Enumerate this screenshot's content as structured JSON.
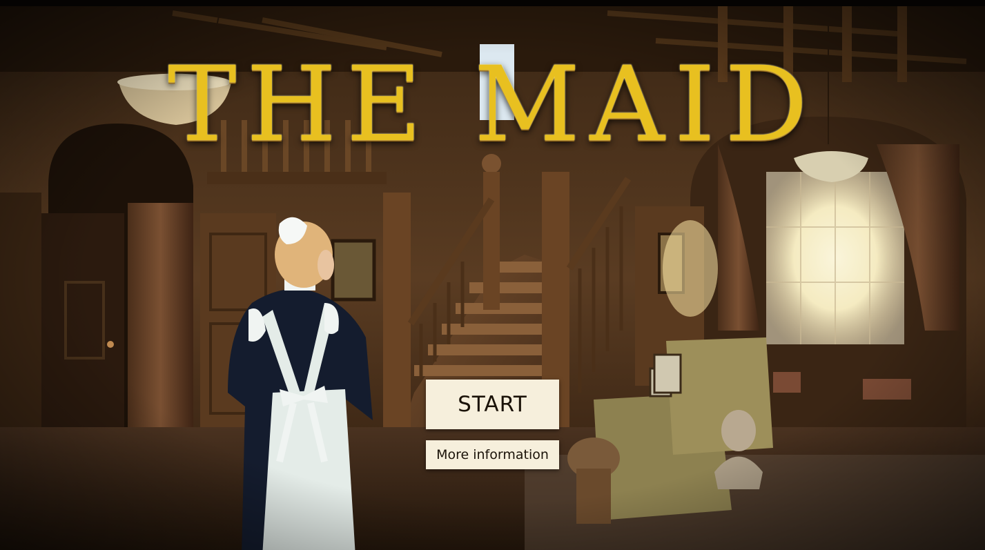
{
  "game": {
    "title": "THE MAID"
  },
  "menu": {
    "start_label": "START",
    "more_info_label": "More information"
  },
  "colors": {
    "title_gold": "#e8c020",
    "button_bg": "#f6efdc",
    "button_text": "#1a1208"
  }
}
